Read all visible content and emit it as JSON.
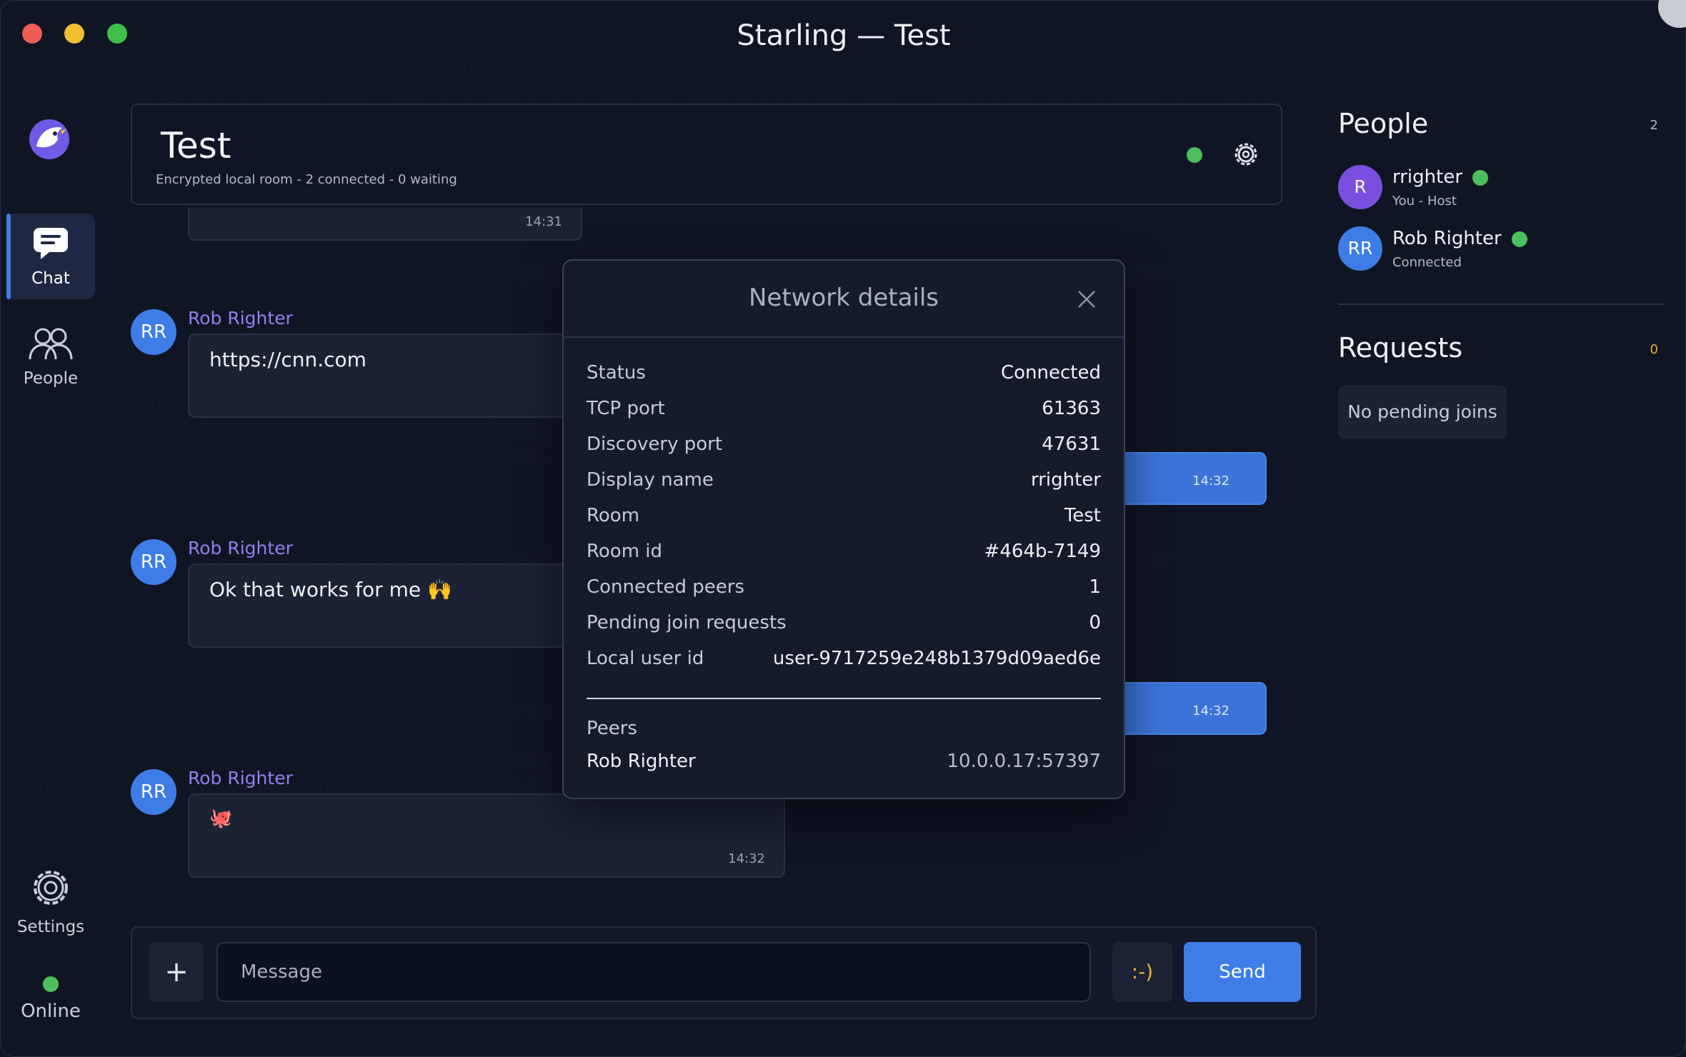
{
  "window": {
    "title": "Starling — Test"
  },
  "background_lines": [
    "te failing tests in core/sfdc-test/func/java/src/core/email/template/EmailTemplateObjectTest.java. Follow the existing JUnit3 style",
    " testXxx, no @Test annotation, see the existing testContainsActiveContent* tests as a precedent — they construct new EmailTemplate",
    " failing tests",
    "llMode_simp",
    "llMode_html",
    "  htmlWithStyleAndLang → <html lang=\"en\" style=\"overflow-y: hidden;\"><head><title></title></head><body>Hi {{{Recipient.Name}}}<",
    "  ct input",
    "  toHtmlTag",
    "  mode visibility from private to package-pr                                     Add a comment explaining why.",
    "  st cont      4 fail with exactly",
    "  fy changi",
    "  Pattern.c",
    "  ts — all 4 sho",
    "",
    " unc-tests in core typically run via bazel.",
    " core/sfdc-test/func/java/src/core/email/temp",
    " lent — the workspace docs and tools/... will                                     confirm the exact target.",
    "",
    "",
    "  victory unle                                                            terministic before/after evidence we need.",
    " ff minimal: 1                                                            cup.",
    " anch base: p4/",
    " rmat: @W-22531186 fix isFullMode regex to ma                                — follow team convention from git log recen",
    "",
    " ing back to this conversation:",
    " ilure output (before fix)",
    " ss output (after fix)",
    " f",
    " expected",
    "",
    "",
    "",
    " ce Claude finishes, paste back the build/test output and the diff and we can review here, file the PR, etc. Tasks #13 and #12",
    "",
    " h #14 #15",
    "",
    "  bug W-22531186 (isFullMode regex rejecting real html attributes) in core. Current task: write failing JUnit tests then appl",
    " laude in your workspace and paste the handoff prompt I drafted."
  ],
  "rail": {
    "chat": "Chat",
    "people": "People",
    "settings": "Settings",
    "online": "Online"
  },
  "room": {
    "title": "Test",
    "subtitle": "Encrypted local room - 2 connected - 0 waiting"
  },
  "messages": [
    {
      "time": "14:31"
    },
    {
      "avatar": "RR",
      "sender": "Rob Righter",
      "text": "https://cnn.com"
    },
    {
      "time": "14:32"
    },
    {
      "avatar": "RR",
      "sender": "Rob Righter",
      "text": "Ok that works for me 🙌"
    },
    {
      "time": "14:32"
    },
    {
      "avatar": "RR",
      "sender": "Rob Righter",
      "text": "🐙",
      "time": "14:32"
    }
  ],
  "composer": {
    "add": "+",
    "placeholder": "Message",
    "emoji": ":-)",
    "send": "Send"
  },
  "people": {
    "title": "People",
    "count": "2",
    "list": [
      {
        "initials": "R",
        "name": "rrighter",
        "sub": "You - Host",
        "color": "#7a4fe0"
      },
      {
        "initials": "RR",
        "name": "Rob Righter",
        "sub": "Connected",
        "color": "#3f7de6"
      }
    ]
  },
  "requests": {
    "title": "Requests",
    "count": "0",
    "empty": "No pending joins"
  },
  "dialog": {
    "title": "Network details",
    "rows": [
      {
        "k": "Status",
        "v": "Connected"
      },
      {
        "k": "TCP port",
        "v": "61363"
      },
      {
        "k": "Discovery port",
        "v": "47631"
      },
      {
        "k": "Display name",
        "v": "rrighter"
      },
      {
        "k": "Room",
        "v": "Test"
      },
      {
        "k": "Room id",
        "v": "#464b-7149"
      },
      {
        "k": "Connected peers",
        "v": "1"
      },
      {
        "k": "Pending join requests",
        "v": "0"
      },
      {
        "k": "Local user id",
        "v": "user-9717259e248b1379d09aed6e"
      }
    ],
    "peers_heading": "Peers",
    "peers": [
      {
        "name": "Rob Righter",
        "addr": "10.0.0.17:57397"
      }
    ]
  },
  "colors": {
    "accent": "#3f7de6",
    "online": "#4dbf5c",
    "sender": "#8f82ee",
    "count_badge": "#f1b233"
  }
}
